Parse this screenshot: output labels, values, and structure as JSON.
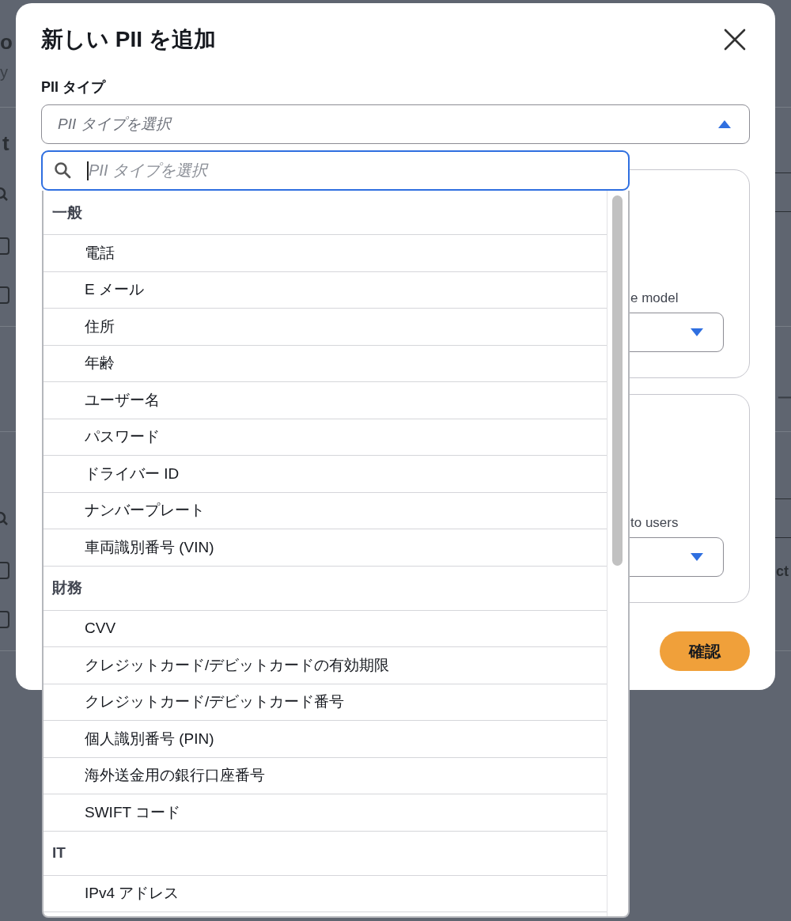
{
  "background": {
    "texts": [
      {
        "text": "o",
        "kind": "heading"
      },
      {
        "text": "y",
        "kind": "note"
      },
      {
        "text": "t",
        "kind": "heading"
      },
      {
        "text": "ー",
        "kind": "note"
      },
      {
        "text": "ct",
        "kind": "label"
      }
    ],
    "checkboxes": [
      {
        "checked": false
      },
      {
        "checked": false
      },
      {
        "checked": false
      },
      {
        "checked": false
      }
    ]
  },
  "dialog": {
    "title": "新しい PII を追加",
    "field_label": "PII タイプ",
    "select": {
      "placeholder": "PII タイプを選択",
      "expanded": true
    },
    "cards": [
      {
        "label": "e model"
      },
      {
        "label": "to users"
      }
    ],
    "confirm_button": "確認",
    "dropdown": {
      "search": {
        "placeholder": "PII タイプを選択"
      },
      "groups": [
        {
          "label": "一般",
          "items": [
            {
              "label": "電話",
              "selected": false
            },
            {
              "label": "E メール",
              "selected": false
            },
            {
              "label": "住所",
              "selected": false
            },
            {
              "label": "年齢",
              "selected": false
            },
            {
              "label": "ユーザー名",
              "selected": false
            },
            {
              "label": "パスワード",
              "selected": false
            },
            {
              "label": "ドライバー ID",
              "selected": false
            },
            {
              "label": "ナンバープレート",
              "selected": false
            },
            {
              "label": "車両識別番号 (VIN)",
              "selected": false
            }
          ]
        },
        {
          "label": "財務",
          "items": [
            {
              "label": "CVV",
              "selected": false
            },
            {
              "label": "クレジットカード/デビットカードの有効期限",
              "selected": false
            },
            {
              "label": "クレジットカード/デビットカード番号",
              "selected": false
            },
            {
              "label": "個人識別番号 (PIN)",
              "selected": false
            },
            {
              "label": "海外送金用の銀行口座番号",
              "selected": false
            },
            {
              "label": "SWIFT コード",
              "selected": false
            }
          ]
        },
        {
          "label": "IT",
          "items": [
            {
              "label": "IPv4 アドレス",
              "selected": false
            }
          ]
        }
      ]
    }
  }
}
